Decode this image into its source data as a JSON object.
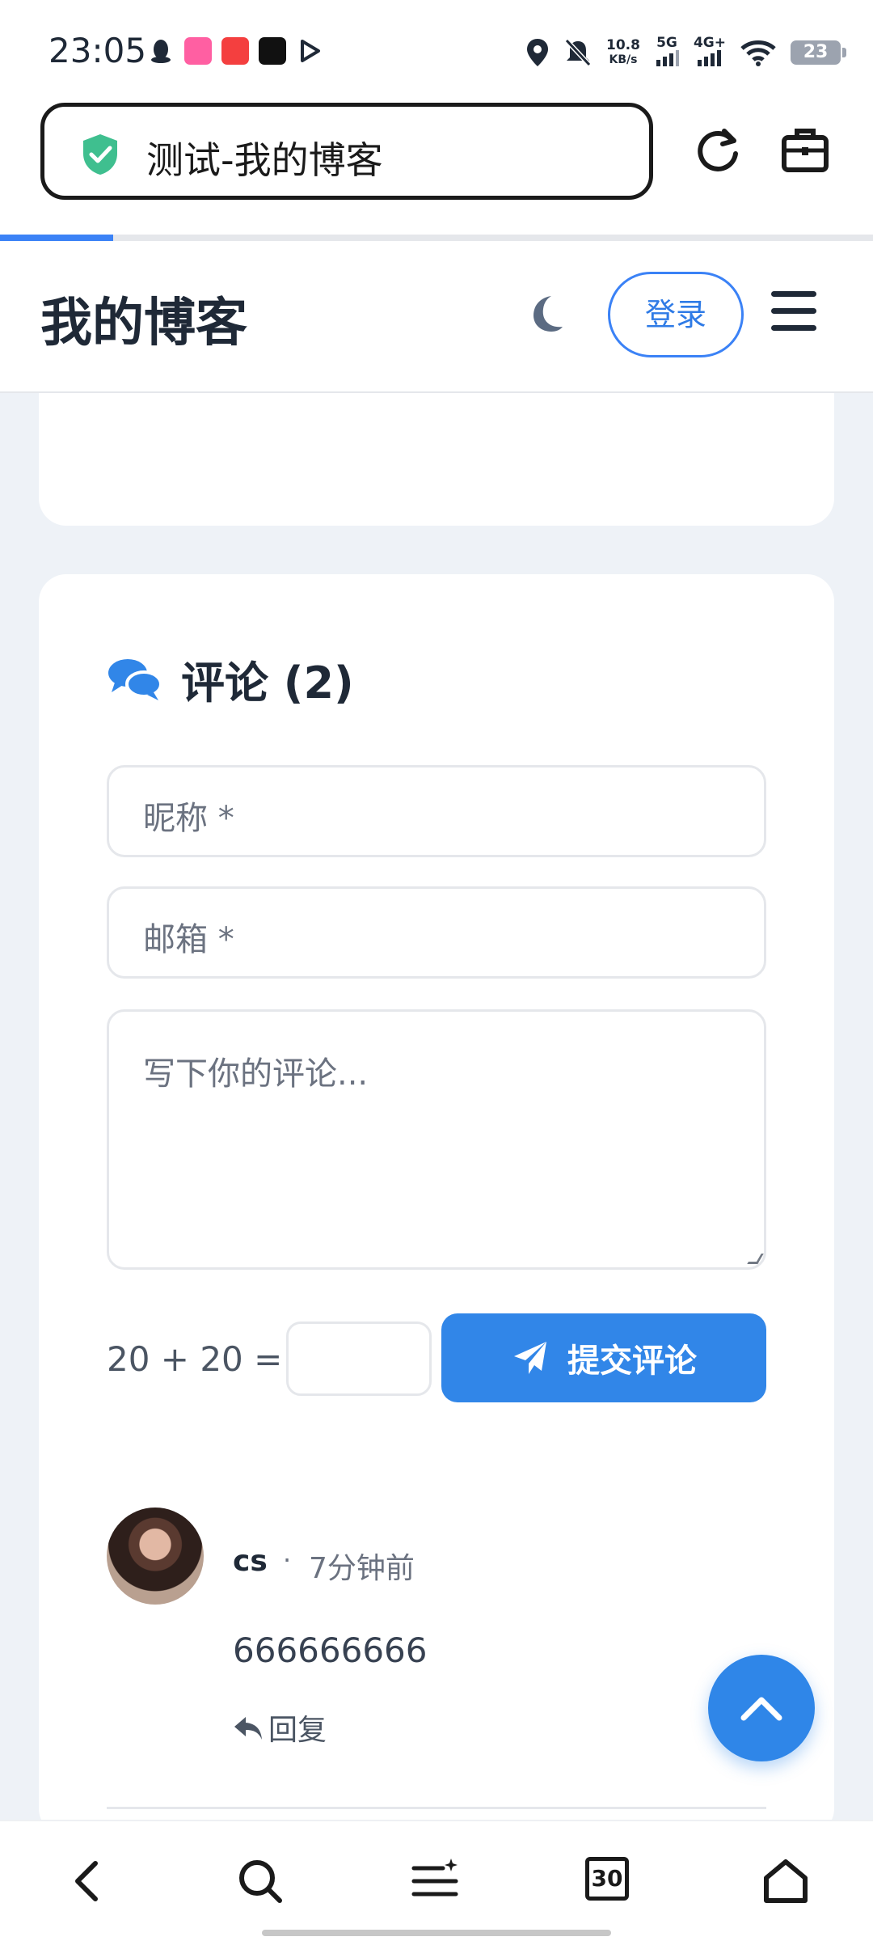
{
  "status_bar": {
    "time": "23:05",
    "net_speed_value": "10.8",
    "net_speed_unit": "KB/s",
    "signal_1": "5G",
    "signal_2": "4G+",
    "battery": "23"
  },
  "browser": {
    "url_title": "测试-我的博客",
    "page_load_progress": 0.13
  },
  "header": {
    "logo": "我的博客",
    "login_label": "登录"
  },
  "comments": {
    "title": "评论 (2)",
    "nickname_placeholder": "昵称 *",
    "email_placeholder": "邮箱 *",
    "comment_placeholder": "写下你的评论...",
    "captcha_question": "20 + 20 = ?",
    "captcha_value": "",
    "submit_label": "提交评论",
    "items": [
      {
        "author": "cs",
        "separator": "·",
        "time": "7分钟前",
        "content": "666666666",
        "reply_label": "回复"
      }
    ]
  },
  "bottom_nav": {
    "tab_count": "30"
  },
  "colors": {
    "accent": "#3186e8",
    "page_bg": "#eef2f7",
    "card_bg": "#ffffff",
    "shield": "#3fbf8f"
  }
}
